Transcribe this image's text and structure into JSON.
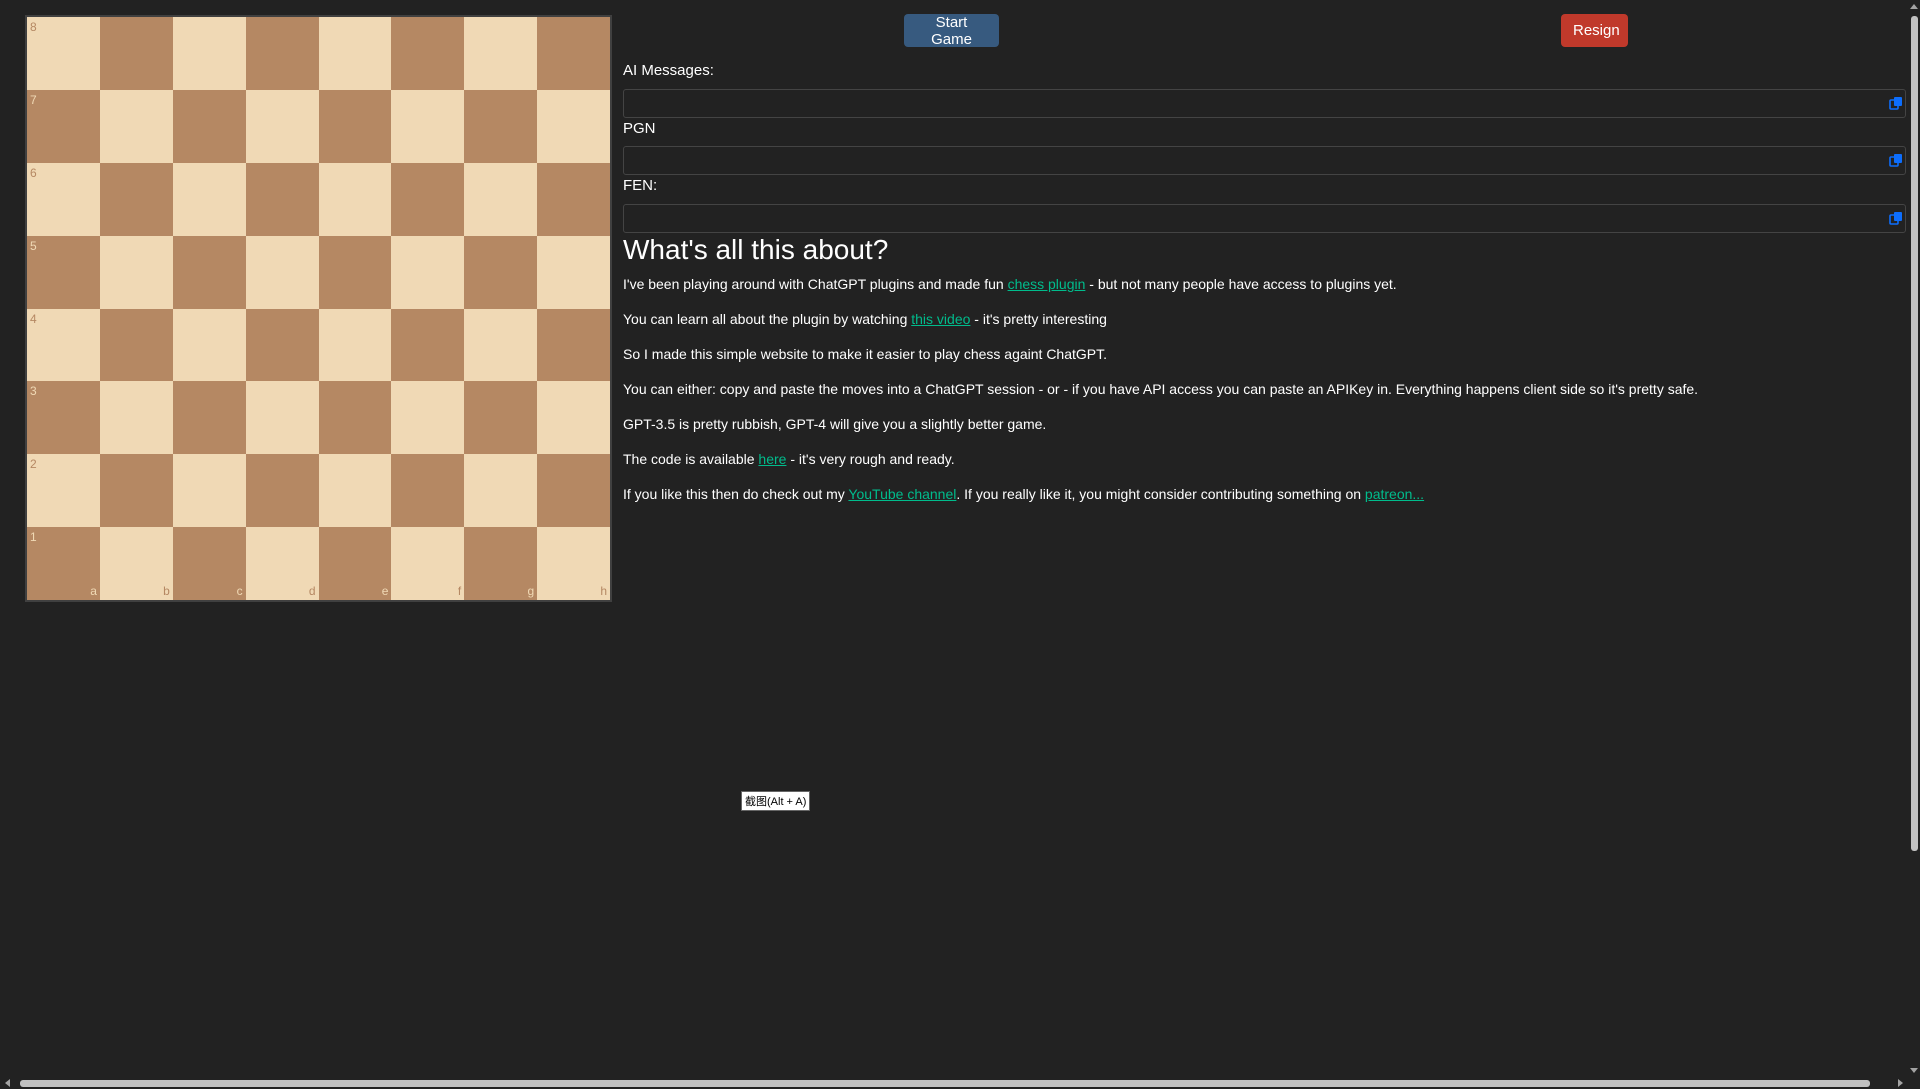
{
  "board": {
    "ranks": [
      "8",
      "7",
      "6",
      "5",
      "4",
      "3",
      "2",
      "1"
    ],
    "files": [
      "a",
      "b",
      "c",
      "d",
      "e",
      "f",
      "g",
      "h"
    ],
    "light_color": "#f0d9b5",
    "dark_color": "#b58863"
  },
  "buttons": {
    "start_label": "Start Game",
    "resign_label": "Resign"
  },
  "fields": {
    "ai_messages_label": "AI Messages:",
    "ai_messages_value": "",
    "pgn_label": "PGN",
    "pgn_value": "",
    "fen_label": "FEN:",
    "fen_value": ""
  },
  "about": {
    "heading": "What's all this about?",
    "p1": {
      "before": "I've been playing around with ChatGPT plugins and made fun ",
      "link": "chess plugin",
      "after": " - but not many people have access to plugins yet."
    },
    "p2": {
      "before": "You can learn all about the plugin by watching ",
      "link": "this video",
      "after": " - it's pretty interesting"
    },
    "p3": {
      "text": "So I made this simple website to make it easier to play chess againt ChatGPT."
    },
    "p4": {
      "text": "You can either: copy and paste the moves into a ChatGPT session - or - if you have API access you can paste an APIKey in. Everything happens client side so it's pretty safe."
    },
    "p5": {
      "text": "GPT-3.5 is pretty rubbish, GPT-4 will give you a slightly better game."
    },
    "p6": {
      "before": "The code is available ",
      "link": "here",
      "after": " - it's very rough and ready."
    },
    "p7": {
      "before": "If you like this then do check out my ",
      "link": "YouTube channel",
      "middle": ". If you really like it, you might consider contributing something on ",
      "link2": "patreon..."
    }
  },
  "tooltip": "截图(Alt + A)",
  "colors": {
    "background": "#222222",
    "start_button": "#375a7f",
    "resign_button": "#c0392b",
    "link": "#00bc8c",
    "copy_icon": "#0d6efd"
  }
}
